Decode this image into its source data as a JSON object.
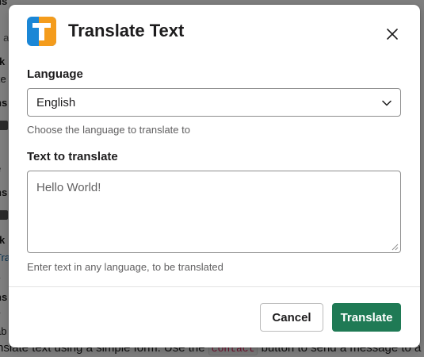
{
  "background": {
    "lines": [
      "ns",
      "s a",
      "rk",
      "ke",
      "ns",
      "e",
      "ns",
      "rk",
      "Tra",
      "y",
      "ns",
      "y",
      "ab"
    ],
    "bottom_text_before": "nslate text using a simple form. Use the ",
    "bottom_code": "contact",
    "bottom_text_after": " button to send a message to a nu"
  },
  "modal": {
    "title": "Translate Text",
    "app_icon_letter": "T",
    "language": {
      "label": "Language",
      "selected": "English",
      "hint": "Choose the language to translate to"
    },
    "text": {
      "label": "Text to translate",
      "value": "Hello World!",
      "hint": "Enter text in any language, to be translated"
    },
    "buttons": {
      "cancel": "Cancel",
      "submit": "Translate"
    }
  },
  "colors": {
    "primary": "#1f7a55",
    "icon_blue": "#1b87d6",
    "icon_orange": "#f49c1c"
  }
}
